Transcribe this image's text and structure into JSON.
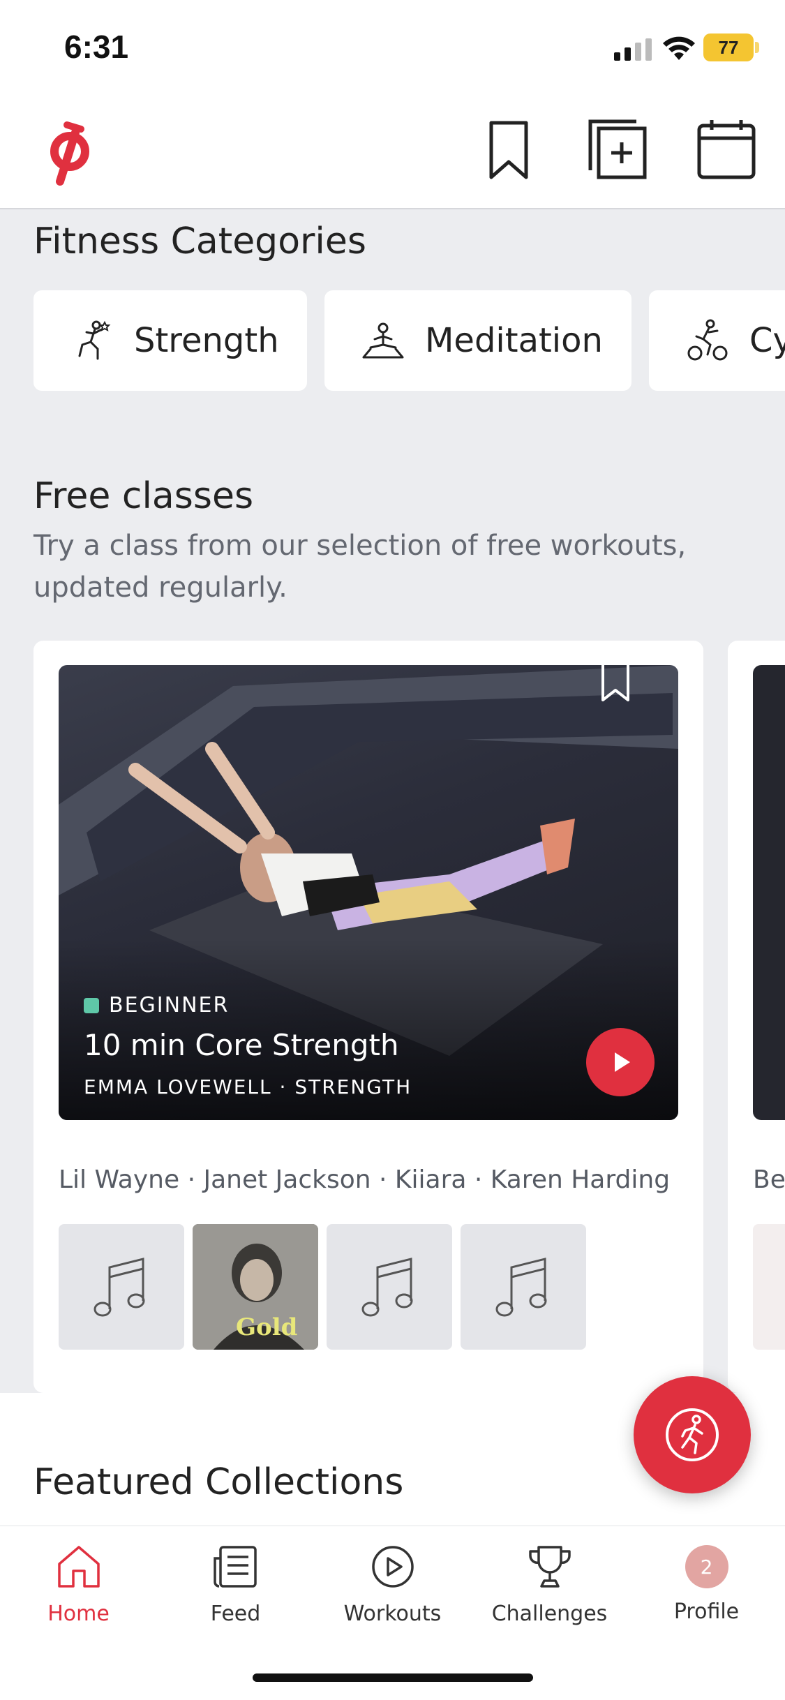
{
  "status_bar": {
    "time": "6:31",
    "battery": "77"
  },
  "header": {
    "logo": "peloton-logo",
    "icons": [
      "bookmark-icon",
      "add-schedule-icon",
      "calendar-icon"
    ]
  },
  "fitness_categories": {
    "title": "Fitness Categories",
    "items": [
      {
        "label": "Strength",
        "icon": "strength-icon"
      },
      {
        "label": "Meditation",
        "icon": "meditation-icon"
      },
      {
        "label": "Cy",
        "icon": "cycling-icon"
      }
    ]
  },
  "free_classes": {
    "title": "Free classes",
    "subtitle": "Try a class from our selection of free workouts, updated regularly.",
    "card": {
      "level": "BEGINNER",
      "title": "10 min Core Strength",
      "subtitle": "EMMA LOVEWELL · STRENGTH",
      "artists": "Lil Wayne · Janet Jackson · Kiiara · Karen Harding",
      "album_text": "Gold"
    },
    "next_card": {
      "artists_peek": "Be"
    }
  },
  "featured_collections": {
    "title": "Featured Collections"
  },
  "tabbar": {
    "items": [
      {
        "label": "Home",
        "icon": "home-icon",
        "active": true
      },
      {
        "label": "Feed",
        "icon": "feed-icon"
      },
      {
        "label": "Workouts",
        "icon": "play-circle-icon"
      },
      {
        "label": "Challenges",
        "icon": "trophy-icon"
      },
      {
        "label": "Profile",
        "icon": "avatar"
      }
    ],
    "profile_badge": "2"
  },
  "colors": {
    "brand_red": "#E0303F",
    "beginner_green": "#5FC8A8",
    "battery_yellow": "#F4C531"
  }
}
